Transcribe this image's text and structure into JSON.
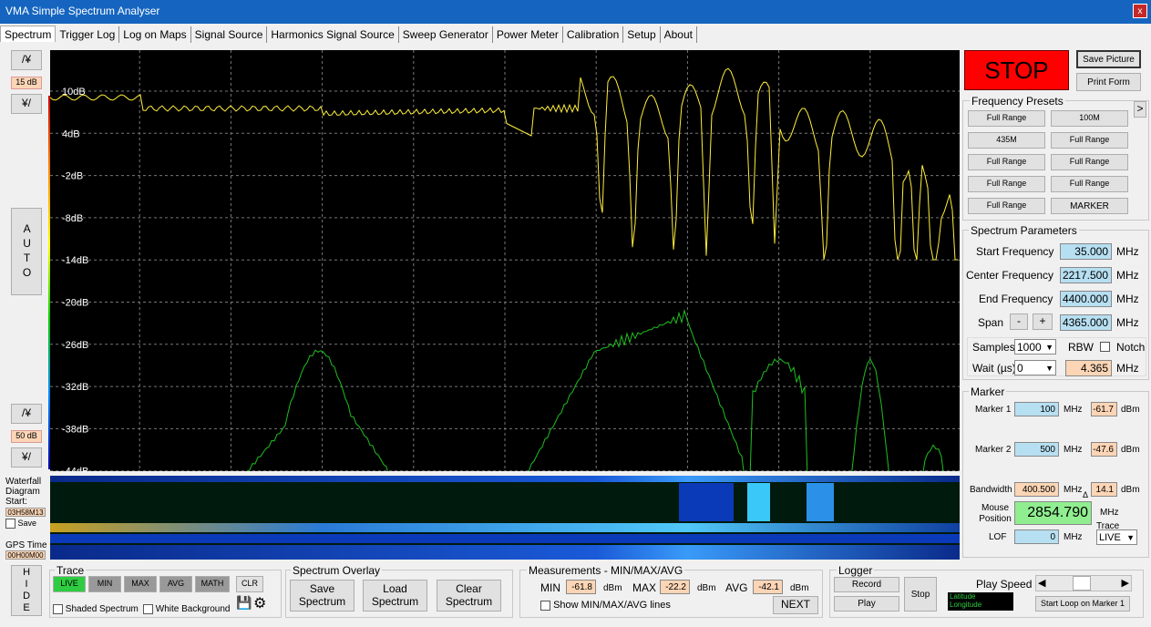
{
  "window": {
    "title": "VMA Simple Spectrum Analyser",
    "close": "x"
  },
  "tabs": [
    "Spectrum",
    "Trigger Log",
    "Log on Maps",
    "Signal Source",
    "Harmonics Signal Source",
    "Sweep Generator",
    "Power Meter",
    "Calibration",
    "Setup",
    "About"
  ],
  "left": {
    "up1": "/¥",
    "db1": "15 dB",
    "down1": "¥/",
    "auto": "AUTO",
    "up2": "/¥",
    "db2": "50 dB",
    "down2": "¥/",
    "waterfall_lbl": "Waterfall Diagram Start:",
    "start_time": "03H58M13",
    "save": "Save",
    "gps": "GPS Time",
    "gps_time": "00H00M00",
    "hide": "HIDE"
  },
  "plot": {
    "ylabels": [
      "10dB",
      "4dB",
      "-2dB",
      "-8dB",
      "-14dB",
      "-20dB",
      "-26dB",
      "-32dB",
      "-38dB",
      "-44dB"
    ]
  },
  "right": {
    "stop": "STOP",
    "save_picture": "Save Picture",
    "print_form": "Print Form",
    "presets_title": "Frequency Presets",
    "presets": [
      "Full Range",
      "100M",
      "435M",
      "Full Range",
      "Full Range",
      "Full Range",
      "Full Range",
      "Full Range",
      "Full Range",
      "MARKER"
    ],
    "arrow": ">",
    "params_title": "Spectrum Parameters",
    "start_lbl": "Start Frequency",
    "start": "35.000",
    "center_lbl": "Center Frequency",
    "center": "2217.500",
    "end_lbl": "End Frequency",
    "end": "4400.000",
    "span_lbl": "Span",
    "span_minus": "-",
    "span_plus": "+",
    "span": "4365.000",
    "mhz": "MHz",
    "samples_lbl": "Samples",
    "samples": "1000",
    "rbw": "RBW",
    "notch": "Notch",
    "wait_lbl": "Wait (µs)",
    "wait": "0",
    "rbw_val": "4.365",
    "marker_title": "Marker",
    "m1_lbl": "Marker 1",
    "m1": "100",
    "m1_dbm": "-61.7",
    "m2_lbl": "Marker 2",
    "m2": "500",
    "m2_dbm": "-47.6",
    "dbm": "dBm",
    "bw_lbl": "Bandwidth",
    "bw": "400.500",
    "bw_dbm": "14.1",
    "delta": "Δ",
    "mouse_lbl": "Mouse Position",
    "mouse": "2854.790",
    "trace_lbl": "Trace",
    "trace": "LIVE",
    "lof_lbl": "LOF",
    "lof": "0"
  },
  "bottom": {
    "trace_title": "Trace",
    "live": "LIVE",
    "min": "MIN",
    "max": "MAX",
    "avg": "AVG",
    "math": "MATH",
    "clr": "CLR",
    "shaded": "Shaded Spectrum",
    "white": "White Background",
    "overlay_title": "Spectrum Overlay",
    "save_spec": "Save Spectrum",
    "load_spec": "Load Spectrum",
    "clear_spec": "Clear Spectrum",
    "meas_title": "Measurements - MIN/MAX/AVG",
    "min_lbl": "MIN",
    "min_val": "-61.8",
    "max_lbl": "MAX",
    "max_val": "-22.2",
    "avg_lbl": "AVG",
    "avg_val": "-42.1",
    "dbm": "dBm",
    "show_lines": "Show MIN/MAX/AVG lines",
    "next": "NEXT",
    "logger_title": "Logger",
    "record": "Record",
    "play": "Play",
    "stop": "Stop",
    "latitude": "Latitude",
    "longitude": "Longitude",
    "play_speed": "Play Speed",
    "start_loop": "Start Loop on Marker 1"
  }
}
